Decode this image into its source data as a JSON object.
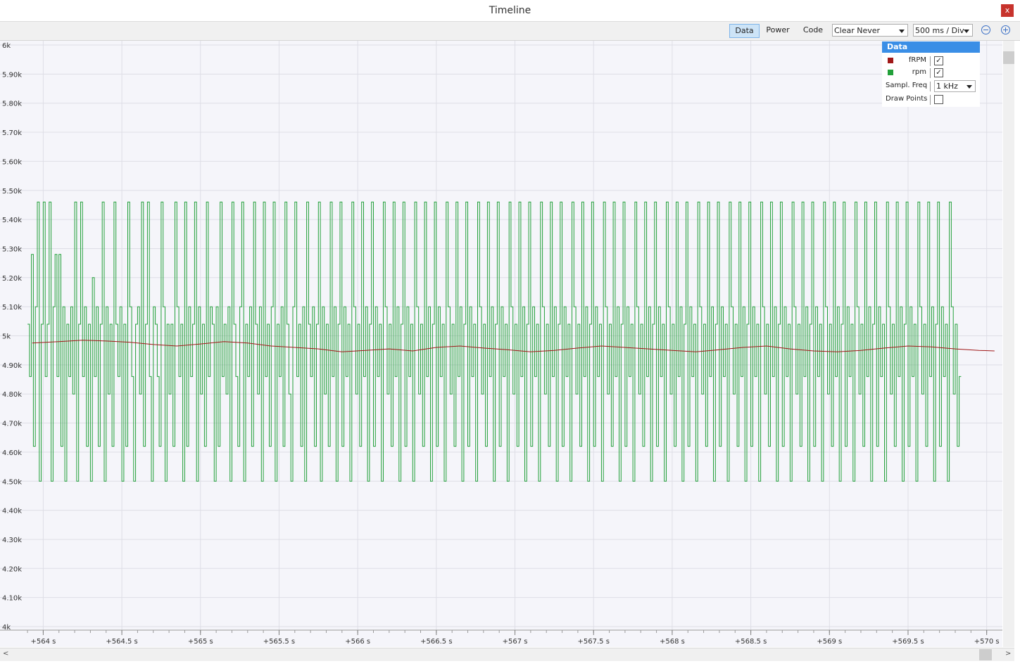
{
  "window": {
    "title": "Timeline",
    "close_label": "x"
  },
  "toolbar": {
    "tabs": [
      "Data",
      "Power",
      "Code"
    ],
    "clear_select": "Clear Never",
    "div_select": "500 ms / Div"
  },
  "legend": {
    "header": "Data",
    "series": [
      {
        "name": "fRPM",
        "color": "#a01818",
        "checked": "✓"
      },
      {
        "name": "rpm",
        "color": "#22a03a",
        "checked": "✓"
      }
    ],
    "sampl_freq_label": "Sampl. Freq",
    "sampl_freq_value": "1 kHz",
    "draw_points_label": "Draw Points",
    "draw_points_checked": ""
  },
  "chart_data": {
    "type": "line",
    "ylim": [
      4000,
      6000
    ],
    "yticks": [
      {
        "v": 6000,
        "label": "6k"
      },
      {
        "v": 5900,
        "label": "5.90k"
      },
      {
        "v": 5800,
        "label": "5.80k"
      },
      {
        "v": 5700,
        "label": "5.70k"
      },
      {
        "v": 5600,
        "label": "5.60k"
      },
      {
        "v": 5500,
        "label": "5.50k"
      },
      {
        "v": 5400,
        "label": "5.40k"
      },
      {
        "v": 5300,
        "label": "5.30k"
      },
      {
        "v": 5200,
        "label": "5.20k"
      },
      {
        "v": 5100,
        "label": "5.10k"
      },
      {
        "v": 5000,
        "label": "5k"
      },
      {
        "v": 4900,
        "label": "4.90k"
      },
      {
        "v": 4800,
        "label": "4.80k"
      },
      {
        "v": 4700,
        "label": "4.70k"
      },
      {
        "v": 4600,
        "label": "4.60k"
      },
      {
        "v": 4500,
        "label": "4.50k"
      },
      {
        "v": 4400,
        "label": "4.40k"
      },
      {
        "v": 4300,
        "label": "4.30k"
      },
      {
        "v": 4200,
        "label": "4.20k"
      },
      {
        "v": 4100,
        "label": "4.10k"
      },
      {
        "v": 4000,
        "label": "4k"
      }
    ],
    "xlim": [
      563.94,
      570.1
    ],
    "xticks": [
      {
        "v": 564.0,
        "label": "+564 s"
      },
      {
        "v": 564.5,
        "label": "+564.5 s"
      },
      {
        "v": 565.0,
        "label": "+565 s"
      },
      {
        "v": 565.5,
        "label": "+565.5 s"
      },
      {
        "v": 566.0,
        "label": "+566 s"
      },
      {
        "v": 566.5,
        "label": "+566.5 s"
      },
      {
        "v": 567.0,
        "label": "+567 s"
      },
      {
        "v": 567.5,
        "label": "+567.5 s"
      },
      {
        "v": 568.0,
        "label": "+568 s"
      },
      {
        "v": 568.5,
        "label": "+568.5 s"
      },
      {
        "v": 569.0,
        "label": "+569 s"
      },
      {
        "v": 569.5,
        "label": "+569.5 s"
      },
      {
        "v": 570.0,
        "label": "+570 s"
      }
    ],
    "series": [
      {
        "name": "rpm",
        "color": "#22a03a",
        "step": true,
        "x_start": 563.9,
        "x_step": 0.0125,
        "values": [
          5040,
          4860,
          5280,
          4620,
          5100,
          5460,
          4500,
          5040,
          5460,
          4860,
          5040,
          5460,
          4500,
          5100,
          5280,
          4860,
          5280,
          4620,
          5100,
          4500,
          5040,
          4860,
          5100,
          4800,
          5460,
          4500,
          5040,
          5460,
          4860,
          5100,
          4620,
          5040,
          4500,
          5200,
          4860,
          5100,
          4620,
          5040,
          5460,
          4500,
          5100,
          4800,
          5040,
          4620,
          5460,
          5040,
          4860,
          5100,
          4500,
          5040,
          4620,
          5460,
          5100,
          4860,
          4500,
          5040,
          5100,
          4800,
          5460,
          4620,
          5040,
          5460,
          4860,
          4500,
          5100,
          5040,
          4860,
          4620,
          5460,
          5100,
          4500,
          5040,
          4800,
          5040,
          4620,
          5460,
          5100,
          4860,
          5040,
          4500,
          5460,
          4620,
          5100,
          4860,
          5040,
          5460,
          4500,
          5100,
          4800,
          5040,
          4620,
          5460,
          4860,
          5100,
          5040,
          4500,
          5100,
          4620,
          5460,
          4860,
          5040,
          4800,
          5100,
          4500,
          5460,
          5040,
          4860,
          4620,
          5100,
          5460,
          4500,
          5040,
          4860,
          5100,
          4620,
          5460,
          5040,
          4800,
          5100,
          4500,
          5460,
          4860,
          5040,
          4620,
          5100,
          5460,
          4500,
          5040,
          4860,
          5100,
          4620,
          5460,
          5040,
          4800,
          4500,
          5100,
          5460,
          4860,
          5040,
          4620,
          5100,
          4500,
          5460,
          5040,
          4860,
          5100,
          4620,
          5040,
          5460,
          4500,
          5100,
          4800,
          5040,
          4620,
          5460,
          4860,
          5100,
          4500,
          5040,
          5460,
          4620,
          5100,
          4860,
          5040,
          4500,
          5460,
          5100,
          4800,
          5040,
          4620,
          5460,
          4860,
          5100,
          4500,
          5040,
          5460,
          4620,
          5100,
          4860,
          5040,
          4500,
          5460,
          5100,
          4800,
          5040,
          4620,
          5460,
          4860,
          5100,
          4500,
          5040,
          5460,
          4620,
          5100,
          4860,
          5040,
          4500,
          5460,
          5100,
          4800,
          5040,
          4620,
          5460,
          4860,
          5100,
          4500,
          5040,
          5460,
          4620,
          5100,
          4860,
          5040,
          4500,
          5460,
          5100,
          4800,
          5040,
          4620,
          5460,
          4860,
          5100,
          4500,
          5040,
          5460,
          4620,
          5100,
          4860,
          5040,
          4500,
          5460,
          5100,
          4800,
          5040,
          4620,
          5460,
          4860,
          5100,
          4500,
          5040,
          5460,
          4620,
          5100,
          4860,
          5040,
          4500,
          5460,
          5100,
          4800,
          5040,
          4620,
          5460,
          4860,
          5100,
          4500,
          5040,
          5460,
          4620,
          5100,
          4860,
          5040,
          4500,
          5460,
          5100,
          4800,
          5040,
          4620,
          5460,
          4860,
          5100,
          4500,
          5040,
          5460,
          4620,
          5100,
          4860,
          5040,
          4500,
          5460,
          5100,
          4800,
          5040,
          4620,
          5460,
          4860,
          5100,
          4500,
          5040,
          5460,
          4620,
          5100,
          4860,
          5040,
          4500,
          5460,
          5100,
          4800,
          5040,
          4620,
          5460,
          4860,
          5100,
          4500,
          5040,
          5460,
          4620,
          5100,
          4860,
          5040,
          4500,
          5460,
          5100,
          4800,
          5040,
          4620,
          5460,
          4860,
          5100,
          4500,
          5040,
          5460,
          4620,
          5100,
          4860,
          5040,
          4500,
          5460,
          5100,
          4800,
          5040,
          4620,
          5460,
          4860,
          5100,
          4500,
          5040,
          5460,
          4620,
          5100,
          4860,
          5040,
          4500,
          5460,
          5100,
          4800,
          5040,
          4620,
          5460,
          4860,
          5100,
          4500,
          5040,
          5460,
          4620,
          5100,
          4860,
          5040,
          4500,
          5460,
          5100,
          4800,
          5040,
          4620,
          5460,
          4860,
          5100,
          4500,
          5040,
          5460,
          4620,
          5100,
          4860,
          5040,
          4500,
          5460,
          5100,
          4800,
          5040,
          4620,
          5460,
          4860,
          5100,
          4500,
          5040,
          5460,
          4620,
          5100,
          4860,
          5040,
          4500,
          5460,
          5100,
          4800,
          5040,
          4620,
          5460,
          4860,
          5100,
          4500,
          5040,
          5460,
          4620,
          5100,
          4860,
          5040,
          4500,
          5460,
          5100,
          4800,
          5040,
          4620,
          5460,
          4860,
          5100,
          4500,
          5040,
          5460,
          4620,
          5100,
          4860,
          5040,
          4500,
          5460,
          5100,
          4800,
          5040,
          4620,
          5460,
          4860,
          5100,
          4500,
          5040,
          5460,
          4620,
          5100,
          4860,
          5040,
          4500,
          5460,
          5100,
          4800,
          5040,
          4620,
          5460,
          4860,
          5100,
          4500,
          5040,
          5460,
          4620,
          5100,
          4860,
          5040,
          4500,
          5460,
          5100,
          4800,
          5040,
          4620,
          5460,
          4860,
          5100,
          4500,
          5040,
          5460,
          4620,
          5100,
          4860,
          5040,
          4500,
          5460,
          5100,
          4800,
          5040,
          4620,
          4860
        ]
      },
      {
        "name": "fRPM",
        "color": "#a01818",
        "step": false,
        "x": [
          563.93,
          564.1,
          564.25,
          564.4,
          564.55,
          564.7,
          564.85,
          565.0,
          565.15,
          565.3,
          565.45,
          565.6,
          565.75,
          565.9,
          566.05,
          566.2,
          566.35,
          566.5,
          566.65,
          566.8,
          566.95,
          567.1,
          567.25,
          567.4,
          567.55,
          567.7,
          567.85,
          568.0,
          568.15,
          568.3,
          568.45,
          568.6,
          568.75,
          568.9,
          569.05,
          569.2,
          569.35,
          569.5,
          569.65,
          569.8,
          569.95,
          570.05
        ],
        "values": [
          4975,
          4980,
          4985,
          4982,
          4978,
          4970,
          4965,
          4972,
          4980,
          4975,
          4965,
          4960,
          4955,
          4945,
          4950,
          4955,
          4948,
          4960,
          4965,
          4958,
          4952,
          4945,
          4950,
          4958,
          4965,
          4960,
          4955,
          4950,
          4945,
          4952,
          4960,
          4965,
          4955,
          4948,
          4945,
          4950,
          4958,
          4965,
          4962,
          4955,
          4950,
          4948
        ]
      }
    ]
  }
}
